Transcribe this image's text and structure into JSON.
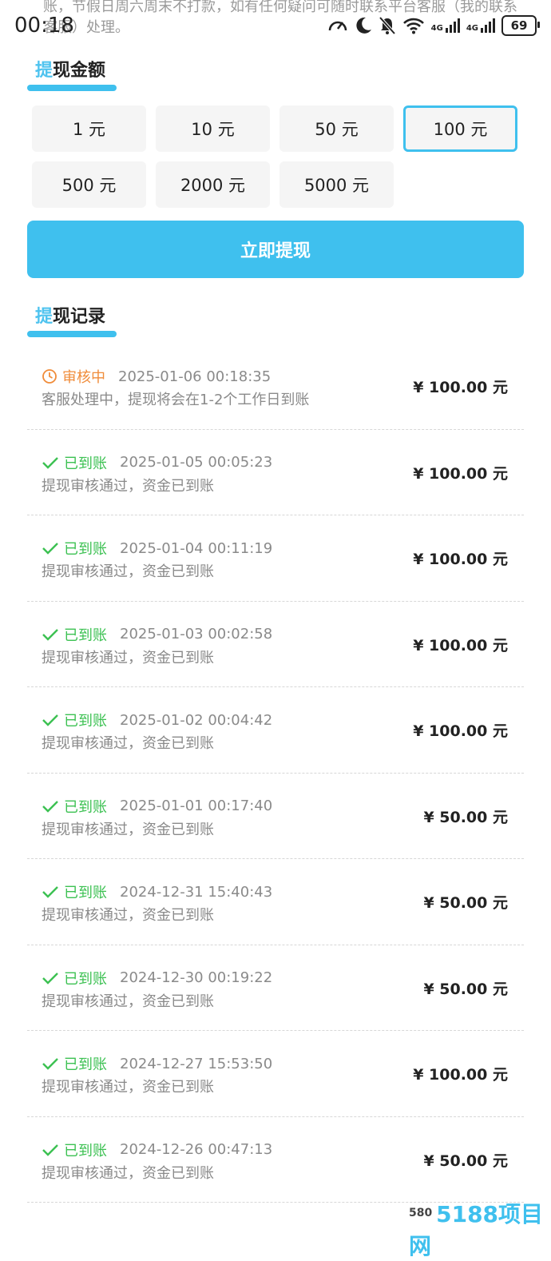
{
  "notice": {
    "text": "账，节假日周六周末不打款，如有任何疑问可随时联系平台客服（我的联系客服）处理。"
  },
  "status_bar": {
    "time": "00:18",
    "battery": "69",
    "network_1": "4G",
    "network_2": "4G"
  },
  "withdraw_amount": {
    "title_highlight": "提",
    "title_rest": "现金额",
    "options": [
      {
        "label": "1 元",
        "selected": false
      },
      {
        "label": "10 元",
        "selected": false
      },
      {
        "label": "50 元",
        "selected": false
      },
      {
        "label": "100 元",
        "selected": true
      },
      {
        "label": "500 元",
        "selected": false
      },
      {
        "label": "2000 元",
        "selected": false
      },
      {
        "label": "5000 元",
        "selected": false
      }
    ]
  },
  "submit_button": {
    "label": "立即提现"
  },
  "withdraw_records": {
    "title_highlight": "提",
    "title_rest": "现记录",
    "items": [
      {
        "status": "审核中",
        "status_type": "pending",
        "time": "2025-01-06 00:18:35",
        "desc": "客服处理中，提现将会在1-2个工作日到账",
        "amount": "¥ 100.00 元"
      },
      {
        "status": "已到账",
        "status_type": "ok",
        "time": "2025-01-05 00:05:23",
        "desc": "提现审核通过，资金已到账",
        "amount": "¥ 100.00 元"
      },
      {
        "status": "已到账",
        "status_type": "ok",
        "time": "2025-01-04 00:11:19",
        "desc": "提现审核通过，资金已到账",
        "amount": "¥ 100.00 元"
      },
      {
        "status": "已到账",
        "status_type": "ok",
        "time": "2025-01-03 00:02:58",
        "desc": "提现审核通过，资金已到账",
        "amount": "¥ 100.00 元"
      },
      {
        "status": "已到账",
        "status_type": "ok",
        "time": "2025-01-02 00:04:42",
        "desc": "提现审核通过，资金已到账",
        "amount": "¥ 100.00 元"
      },
      {
        "status": "已到账",
        "status_type": "ok",
        "time": "2025-01-01 00:17:40",
        "desc": "提现审核通过，资金已到账",
        "amount": "¥ 50.00 元"
      },
      {
        "status": "已到账",
        "status_type": "ok",
        "time": "2024-12-31 15:40:43",
        "desc": "提现审核通过，资金已到账",
        "amount": "¥ 50.00 元"
      },
      {
        "status": "已到账",
        "status_type": "ok",
        "time": "2024-12-30 00:19:22",
        "desc": "提现审核通过，资金已到账",
        "amount": "¥ 50.00 元"
      },
      {
        "status": "已到账",
        "status_type": "ok",
        "time": "2024-12-27 15:53:50",
        "desc": "提现审核通过，资金已到账",
        "amount": "¥ 100.00 元"
      },
      {
        "status": "已到账",
        "status_type": "ok",
        "time": "2024-12-26 00:47:13",
        "desc": "提现审核通过，资金已到账",
        "amount": "¥ 50.00 元"
      }
    ]
  },
  "watermark": {
    "prefix": "580",
    "logo": "5188项目网"
  },
  "colors": {
    "accent": "#3fc0ee",
    "ok": "#3cc152",
    "pending": "#f08c3a",
    "muted": "#8a8a8a"
  }
}
